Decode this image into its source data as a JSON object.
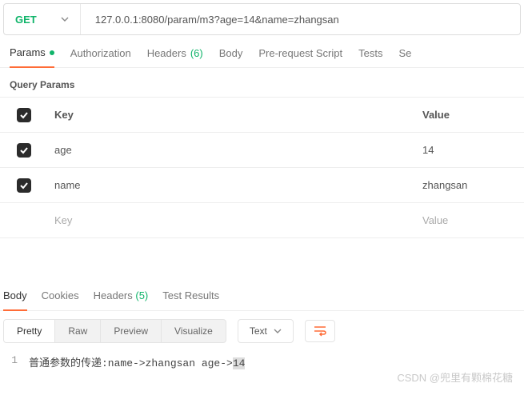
{
  "request": {
    "method": "GET",
    "url": "127.0.0.1:8080/param/m3?age=14&name=zhangsan"
  },
  "tabs": {
    "params": "Params",
    "auth": "Authorization",
    "headers": "Headers",
    "headers_count": "(6)",
    "body": "Body",
    "prerequest": "Pre-request Script",
    "tests": "Tests",
    "settings": "Se"
  },
  "query": {
    "title": "Query Params",
    "key_header": "Key",
    "value_header": "Value",
    "rows": [
      {
        "key": "age",
        "value": "14"
      },
      {
        "key": "name",
        "value": "zhangsan"
      }
    ],
    "key_placeholder": "Key",
    "value_placeholder": "Value"
  },
  "response": {
    "tabs": {
      "body": "Body",
      "cookies": "Cookies",
      "headers": "Headers",
      "headers_count": "(5)",
      "results": "Test Results"
    },
    "views": {
      "pretty": "Pretty",
      "raw": "Raw",
      "preview": "Preview",
      "visualize": "Visualize"
    },
    "mode": "Text",
    "line_no": "1",
    "body_prefix": "普通参数的传递:name->zhangsan age->",
    "body_hl": "14"
  },
  "watermark": "CSDN @兜里有颗棉花糖"
}
